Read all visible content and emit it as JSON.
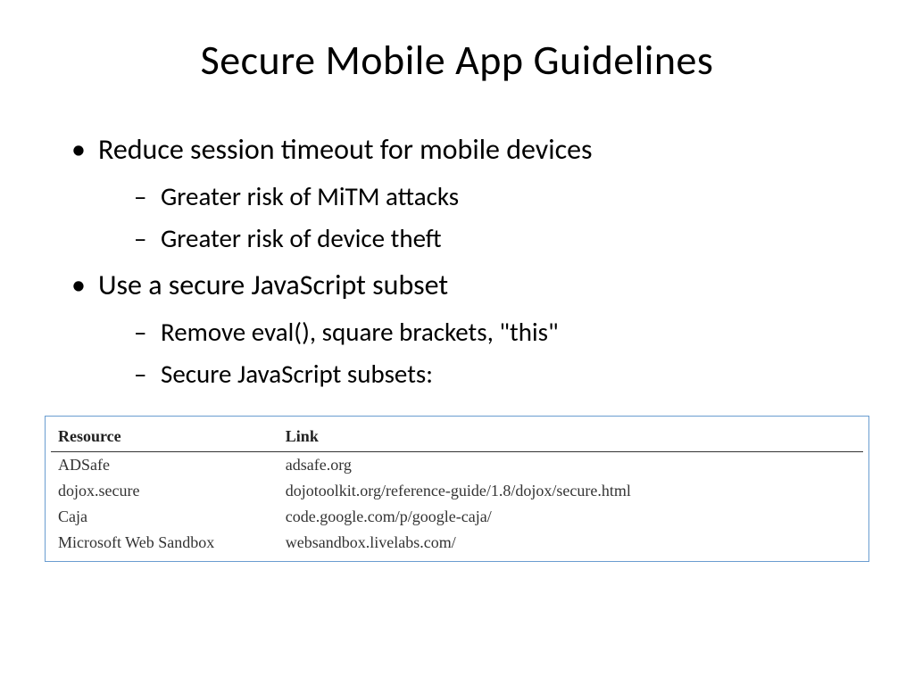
{
  "title": "Secure Mobile App Guidelines",
  "bullets": [
    {
      "text": "Reduce session timeout for mobile devices",
      "subs": [
        "Greater risk of MiTM attacks",
        "Greater risk of device theft"
      ]
    },
    {
      "text": "Use a secure JavaScript subset",
      "subs": [
        "Remove eval(), square brackets, \"this\"",
        "Secure JavaScript subsets:"
      ]
    }
  ],
  "table": {
    "headers": [
      "Resource",
      "Link"
    ],
    "rows": [
      [
        "ADSafe",
        "adsafe.org"
      ],
      [
        "dojox.secure",
        "dojotoolkit.org/reference-guide/1.8/dojox/secure.html"
      ],
      [
        "Caja",
        "code.google.com/p/google-caja/"
      ],
      [
        "Microsoft Web Sandbox",
        "websandbox.livelabs.com/"
      ]
    ]
  }
}
